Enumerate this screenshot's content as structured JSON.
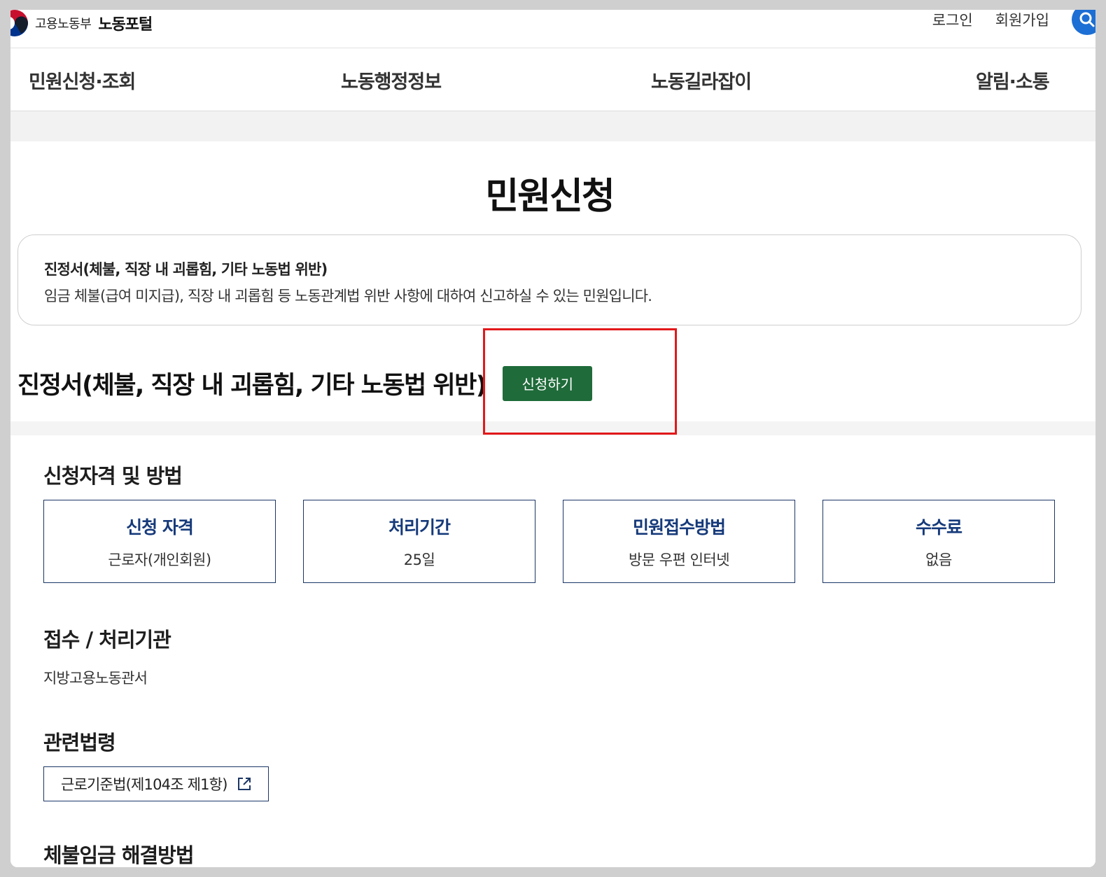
{
  "header": {
    "org_name": "고용노동부",
    "portal_name": "노동포털",
    "login": "로그인",
    "signup": "회원가입"
  },
  "gnb": [
    {
      "label": "민원신청·조회"
    },
    {
      "label": "노동행정정보"
    },
    {
      "label": "노동길라잡이"
    },
    {
      "label": "알림·소통"
    }
  ],
  "page": {
    "title": "민원신청"
  },
  "intro": {
    "title": "진정서(체불, 직장 내 괴롭힘, 기타 노동법 위반)",
    "description": "임금 체불(급여 미지급), 직장 내 괴롭힘 등 노동관계법 위반 사항에 대하여 신고하실 수 있는 민원입니다."
  },
  "service": {
    "title": "진정서(체불, 직장 내 괴롭힘, 기타 노동법 위반)",
    "apply_label": "신청하기"
  },
  "qualification": {
    "heading": "신청자격 및 방법",
    "cards": [
      {
        "title": "신청 자격",
        "value": "근로자(개인회원)"
      },
      {
        "title": "처리기간",
        "value": "25일"
      },
      {
        "title": "민원접수방법",
        "value": "방문 우편 인터넷"
      },
      {
        "title": "수수료",
        "value": "없음"
      }
    ]
  },
  "agency": {
    "heading": "접수 / 처리기관",
    "value": "지방고용노동관서"
  },
  "laws": {
    "heading": "관련법령",
    "link_label": "근로기준법(제104조 제1항)"
  },
  "resolution": {
    "heading": "체불임금 해결방법"
  },
  "colors": {
    "apply_button": "#1f6b3a",
    "card_title": "#163a7a",
    "search_button": "#1c6fd4",
    "highlight": "#e2181a"
  }
}
